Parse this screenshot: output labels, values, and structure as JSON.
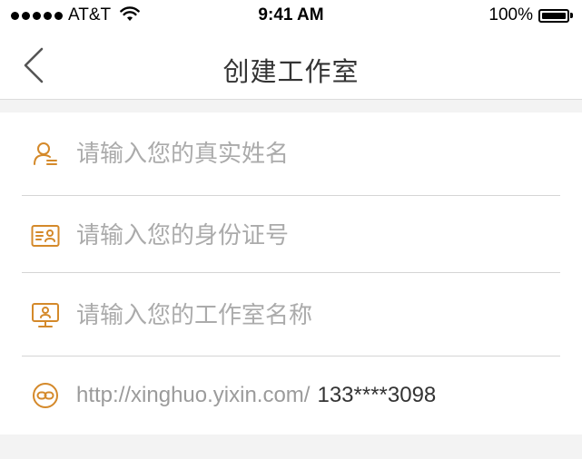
{
  "status_bar": {
    "carrier": "AT&T",
    "time": "9:41 AM",
    "battery": "100%"
  },
  "nav": {
    "title": "创建工作室",
    "back_icon": "chevron-left-icon"
  },
  "form": {
    "name_placeholder": "请输入您的真实姓名",
    "id_placeholder": "请输入您的身份证号",
    "studio_placeholder": "请输入您的工作室名称",
    "link_prefix": "http://xinghuo.yixin.com/",
    "link_value": "133****3098"
  },
  "colors": {
    "icon_accent": "#d4892a",
    "placeholder": "#ababab",
    "background": "#f3f3f3"
  }
}
